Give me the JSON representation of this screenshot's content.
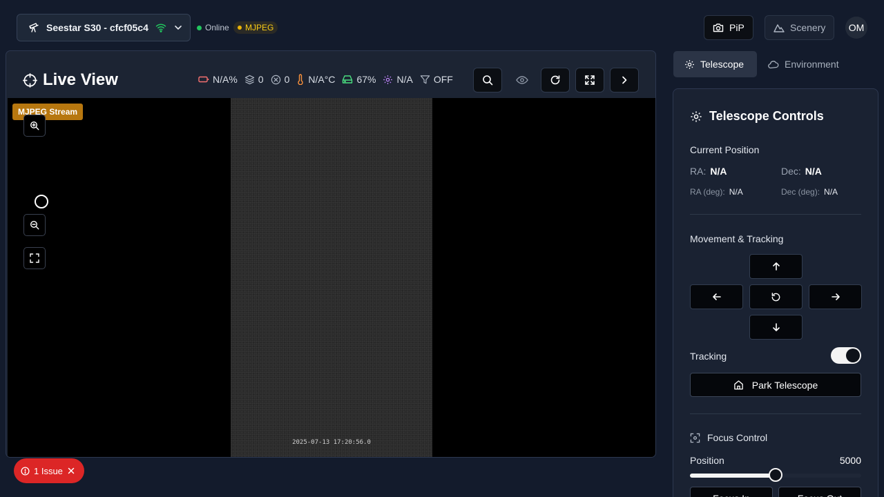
{
  "header": {
    "device_name": "Seestar S30 - cfcf05c4",
    "status_online": "Online",
    "status_stream": "MJPEG",
    "pip_label": "PiP",
    "scenery_label": "Scenery",
    "avatar_initials": "OM"
  },
  "live_view": {
    "title": "Live View",
    "stats": {
      "battery": "N/A%",
      "stacked": "0",
      "dropped": "0",
      "temperature": "N/A°C",
      "storage": "67%",
      "gain": "N/A",
      "filter": "OFF"
    },
    "stream_badge": "MJPEG Stream",
    "timestamp": "2025-07-13 17:20:56.0"
  },
  "issues": {
    "label": "1 Issue"
  },
  "tabs": [
    {
      "label": "Telescope",
      "active": true
    },
    {
      "label": "Environment",
      "active": false
    }
  ],
  "telescope": {
    "title": "Telescope Controls",
    "current_position_label": "Current Position",
    "ra_label": "RA:",
    "ra_value": "N/A",
    "dec_label": "Dec:",
    "dec_value": "N/A",
    "ra_deg_label": "RA (deg):",
    "ra_deg_value": "N/A",
    "dec_deg_label": "Dec (deg):",
    "dec_deg_value": "N/A",
    "movement_label": "Movement & Tracking",
    "tracking_label": "Tracking",
    "tracking_on": true,
    "park_label": "Park Telescope",
    "focus_label": "Focus Control",
    "position_label": "Position",
    "position_value": "5000",
    "position_fraction": 0.5,
    "focus_in_label": "Focus In",
    "focus_out_label": "Focus Out"
  },
  "colors": {
    "background": "#131b2c",
    "online": "#22c55e",
    "stream": "#eab308",
    "issue": "#dc2626",
    "badge": "#b7770f"
  }
}
